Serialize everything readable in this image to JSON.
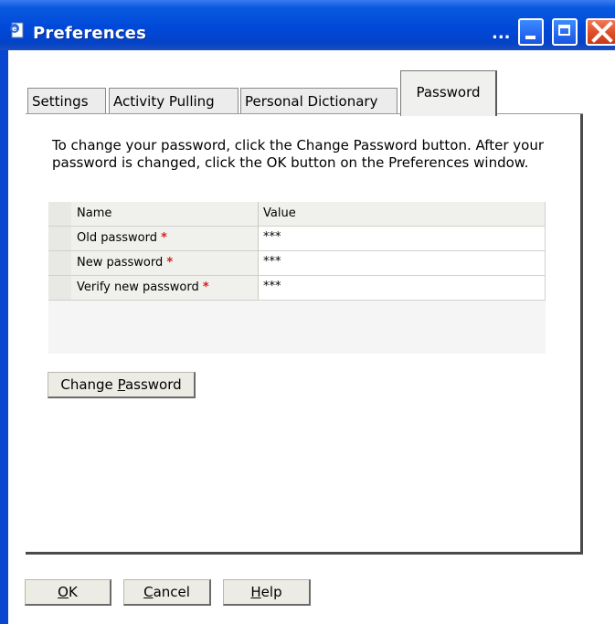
{
  "window": {
    "title": "Preferences",
    "overflow": "...",
    "icon": "ie-document-icon"
  },
  "tabs": [
    {
      "label": "Settings",
      "active": false
    },
    {
      "label": "Activity Pulling",
      "active": false
    },
    {
      "label": "Personal Dictionary",
      "active": false
    },
    {
      "label": "Password",
      "active": true
    }
  ],
  "password_tab": {
    "instructions": "To change your password, click the Change Password button. After your password is changed, click the OK button on the Preferences window.",
    "grid": {
      "headers": {
        "name": "Name",
        "value": "Value"
      },
      "rows": [
        {
          "name": "Old password",
          "required": "*",
          "value": "***"
        },
        {
          "name": "New password",
          "required": "*",
          "value": "***"
        },
        {
          "name": "Verify new password",
          "required": "*",
          "value": "***"
        }
      ]
    },
    "change_button": {
      "pre": "Change ",
      "accel": "P",
      "post": "assword"
    }
  },
  "footer": {
    "ok": {
      "pre": "",
      "accel": "O",
      "post": "K"
    },
    "cancel": {
      "pre": "",
      "accel": "C",
      "post": "ancel"
    },
    "help": {
      "pre": "",
      "accel": "H",
      "post": "elp"
    }
  },
  "colors": {
    "titlebar": "#0048d8",
    "required_star": "#d02020",
    "close_button": "#e0502a"
  }
}
